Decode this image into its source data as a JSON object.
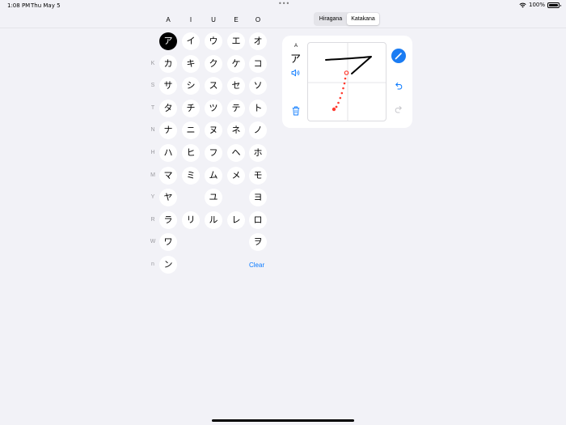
{
  "status_bar": {
    "time": "1:08 PM",
    "date": "Thu May 5",
    "dots": "•••",
    "battery": "100%",
    "wifi_icon": "wifi-icon",
    "battery_icon": "battery-icon"
  },
  "segmented": {
    "options": [
      "Hiragana",
      "Katakana"
    ],
    "selected": "Katakana"
  },
  "columns": [
    "A",
    "I",
    "U",
    "E",
    "O"
  ],
  "rows": [
    {
      "label": "",
      "kana": [
        "ア",
        "イ",
        "ウ",
        "エ",
        "オ"
      ]
    },
    {
      "label": "K",
      "kana": [
        "カ",
        "キ",
        "ク",
        "ケ",
        "コ"
      ]
    },
    {
      "label": "S",
      "kana": [
        "サ",
        "シ",
        "ス",
        "セ",
        "ソ"
      ]
    },
    {
      "label": "T",
      "kana": [
        "タ",
        "チ",
        "ツ",
        "テ",
        "ト"
      ]
    },
    {
      "label": "N",
      "kana": [
        "ナ",
        "ニ",
        "ヌ",
        "ネ",
        "ノ"
      ]
    },
    {
      "label": "H",
      "kana": [
        "ハ",
        "ヒ",
        "フ",
        "ヘ",
        "ホ"
      ]
    },
    {
      "label": "M",
      "kana": [
        "マ",
        "ミ",
        "ム",
        "メ",
        "モ"
      ]
    },
    {
      "label": "Y",
      "kana": [
        "ヤ",
        "",
        "ユ",
        "",
        "ヨ"
      ]
    },
    {
      "label": "R",
      "kana": [
        "ラ",
        "リ",
        "ル",
        "レ",
        "ロ"
      ]
    },
    {
      "label": "W",
      "kana": [
        "ワ",
        "",
        "",
        "",
        "ヲ"
      ]
    },
    {
      "label": "n",
      "kana": [
        "ン",
        "",
        "",
        "",
        ""
      ]
    }
  ],
  "selected_kana": "ア",
  "clear_label": "Clear",
  "practice_card": {
    "romaji": "A",
    "kana": "ア",
    "speaker_icon": "speaker-icon",
    "trash_icon": "trash-icon",
    "pen_icon": "pencil-icon",
    "undo_icon": "undo-icon",
    "redo_icon": "redo-icon"
  },
  "colors": {
    "accent": "#0a7aff",
    "background": "#f2f2f7",
    "selected_kana_bg": "#000000",
    "guide_stroke": "#ff3b30",
    "user_stroke": "#000000"
  }
}
